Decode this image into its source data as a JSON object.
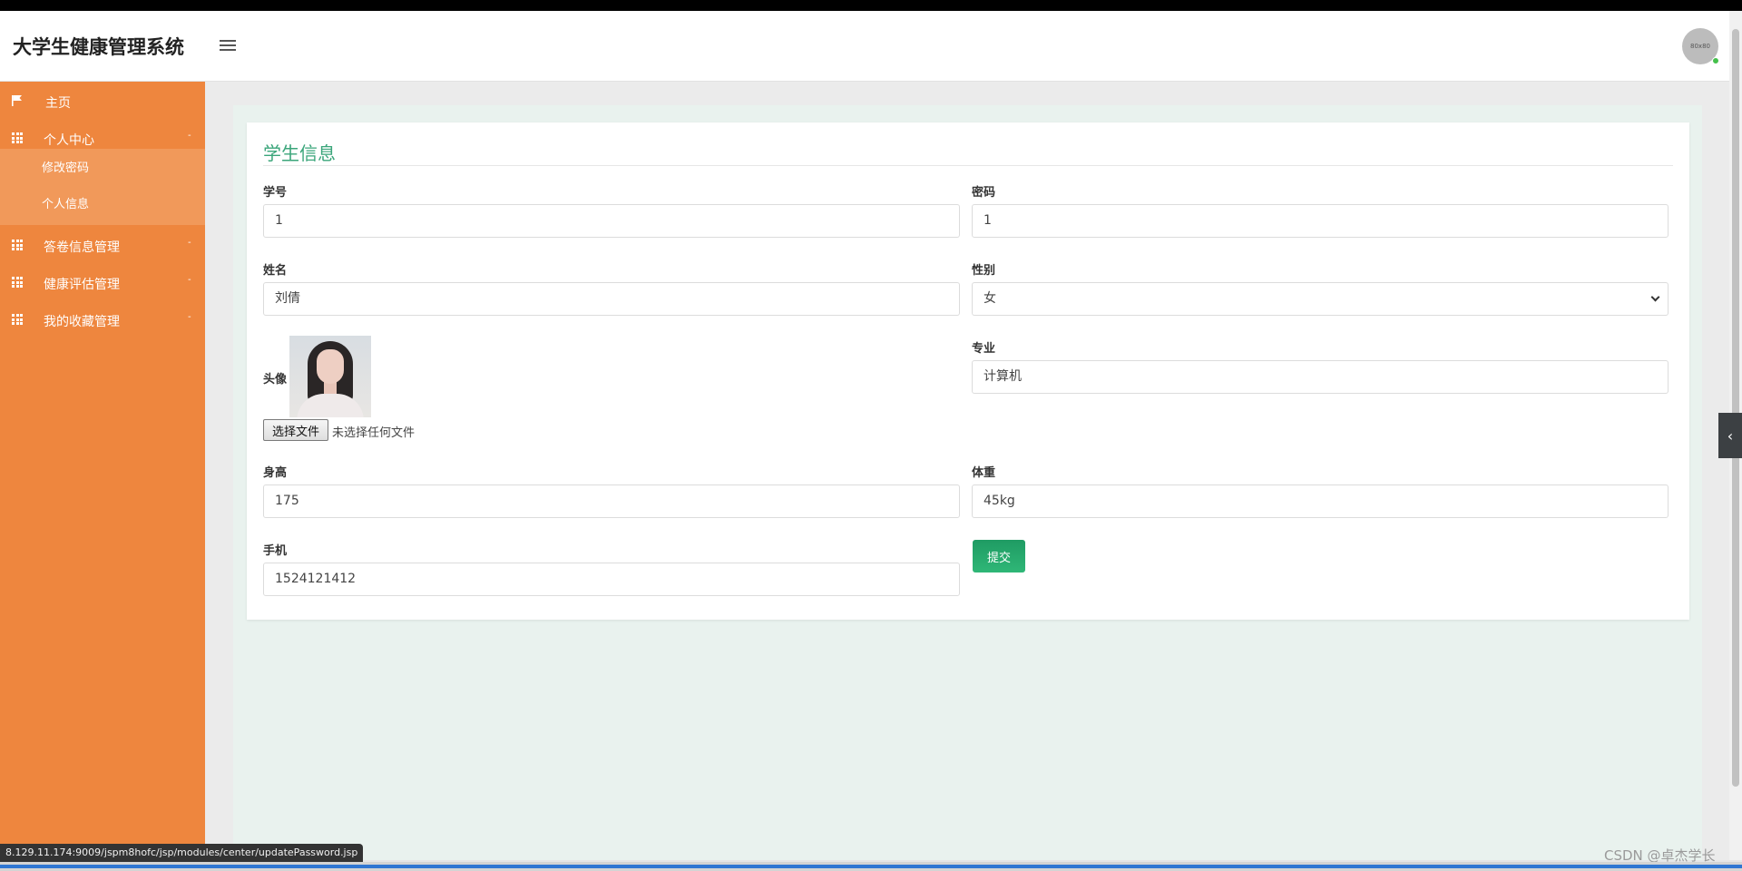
{
  "app": {
    "title": "大学生健康管理系统"
  },
  "header": {
    "avatar_text": "80x80"
  },
  "sidebar": {
    "items": [
      {
        "label": "主页",
        "icon": "flag-icon"
      },
      {
        "label": "个人中心",
        "icon": "grid-icon",
        "caret": "-"
      },
      {
        "label": "答卷信息管理",
        "icon": "grid-icon",
        "caret": "-"
      },
      {
        "label": "健康评估管理",
        "icon": "grid-icon",
        "caret": "-"
      },
      {
        "label": "我的收藏管理",
        "icon": "grid-icon",
        "caret": "-"
      }
    ],
    "subitems": [
      {
        "label": "修改密码"
      },
      {
        "label": "个人信息"
      }
    ]
  },
  "form": {
    "title": "学生信息",
    "student_id": {
      "label": "学号",
      "value": "1"
    },
    "password": {
      "label": "密码",
      "value": "1"
    },
    "name": {
      "label": "姓名",
      "value": "刘倩"
    },
    "gender": {
      "label": "性别",
      "value": "女"
    },
    "avatar": {
      "label": "头像",
      "file_button": "选择文件",
      "file_status": "未选择任何文件"
    },
    "major": {
      "label": "专业",
      "value": "计算机"
    },
    "height": {
      "label": "身高",
      "value": "175"
    },
    "weight": {
      "label": "体重",
      "value": "45kg"
    },
    "phone": {
      "label": "手机",
      "value": "1524121412"
    },
    "submit_label": "提交"
  },
  "status_bar": {
    "url": "8.129.11.174:9009/jspm8hofc/jsp/modules/center/updatePassword.jsp"
  },
  "watermark": "CSDN @卓杰学长",
  "colors": {
    "sidebar": "#ee863e",
    "submenu": "#f1995a",
    "accent": "#3aa57a",
    "submit": "#2aa86d"
  }
}
